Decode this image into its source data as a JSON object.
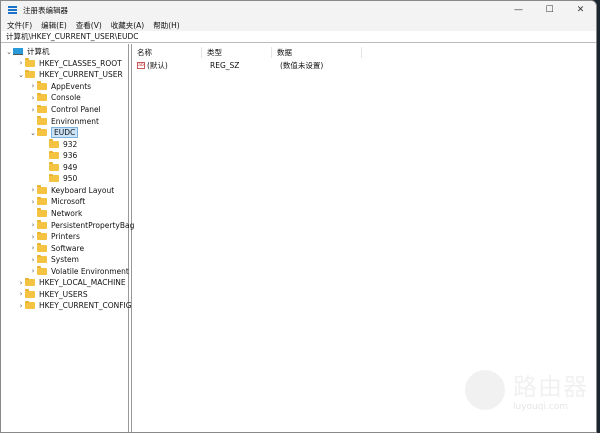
{
  "window": {
    "title": "注册表编辑器",
    "minimize": "—",
    "maximize": "☐",
    "close": "✕"
  },
  "menu": [
    "文件(F)",
    "编辑(E)",
    "查看(V)",
    "收藏夹(A)",
    "帮助(H)"
  ],
  "address": "计算机\\HKEY_CURRENT_USER\\EUDC",
  "tree": [
    {
      "label": "计算机",
      "level": 0,
      "exp": "open",
      "icon": "computer"
    },
    {
      "label": "HKEY_CLASSES_ROOT",
      "level": 1,
      "exp": "closed"
    },
    {
      "label": "HKEY_CURRENT_USER",
      "level": 1,
      "exp": "open"
    },
    {
      "label": "AppEvents",
      "level": 2,
      "exp": "closed"
    },
    {
      "label": "Console",
      "level": 2,
      "exp": "closed"
    },
    {
      "label": "Control Panel",
      "level": 2,
      "exp": "closed"
    },
    {
      "label": "Environment",
      "level": 2,
      "exp": "none"
    },
    {
      "label": "EUDC",
      "level": 2,
      "exp": "open",
      "selected": true
    },
    {
      "label": "932",
      "level": 3,
      "exp": "none"
    },
    {
      "label": "936",
      "level": 3,
      "exp": "none"
    },
    {
      "label": "949",
      "level": 3,
      "exp": "none"
    },
    {
      "label": "950",
      "level": 3,
      "exp": "none"
    },
    {
      "label": "Keyboard Layout",
      "level": 2,
      "exp": "closed"
    },
    {
      "label": "Microsoft",
      "level": 2,
      "exp": "closed"
    },
    {
      "label": "Network",
      "level": 2,
      "exp": "none"
    },
    {
      "label": "PersistentPropertyBag",
      "level": 2,
      "exp": "closed"
    },
    {
      "label": "Printers",
      "level": 2,
      "exp": "closed"
    },
    {
      "label": "Software",
      "level": 2,
      "exp": "closed"
    },
    {
      "label": "System",
      "level": 2,
      "exp": "closed"
    },
    {
      "label": "Volatile Environment",
      "level": 2,
      "exp": "closed"
    },
    {
      "label": "HKEY_LOCAL_MACHINE",
      "level": 1,
      "exp": "closed"
    },
    {
      "label": "HKEY_USERS",
      "level": 1,
      "exp": "closed"
    },
    {
      "label": "HKEY_CURRENT_CONFIG",
      "level": 1,
      "exp": "closed"
    }
  ],
  "columns": [
    "名称",
    "类型",
    "数据"
  ],
  "values": [
    {
      "name": "(默认)",
      "type": "REG_SZ",
      "data": "(数值未设置)",
      "icon": "ab"
    }
  ],
  "watermark": {
    "text": "路由器",
    "url": "luyouqi.com"
  }
}
